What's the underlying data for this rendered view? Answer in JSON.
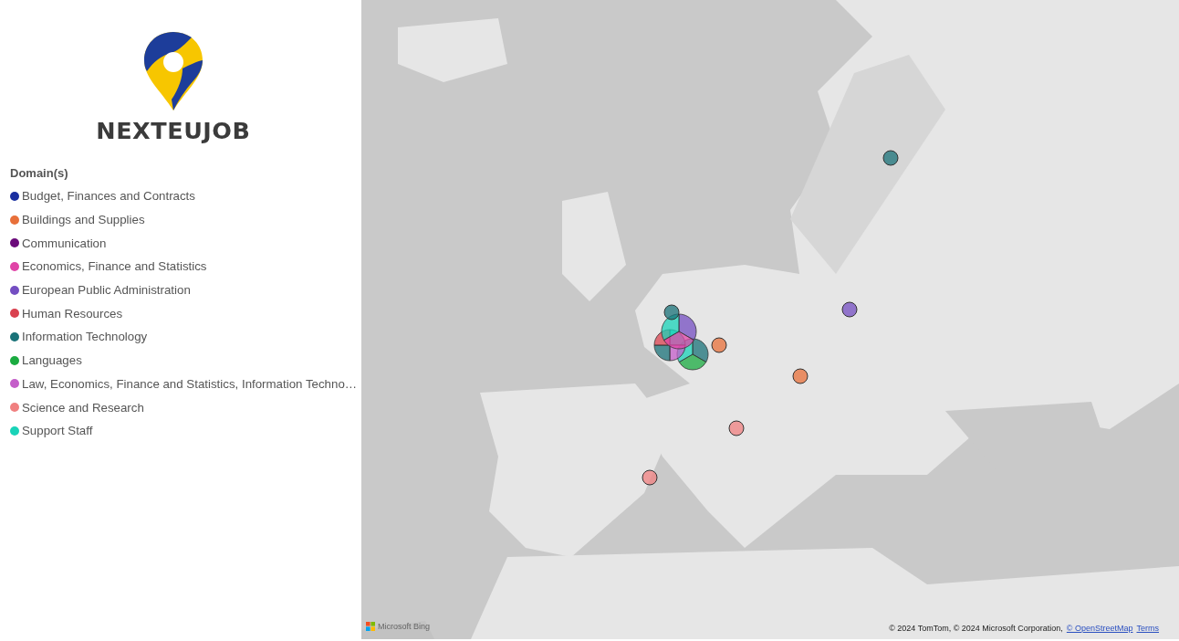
{
  "logo": {
    "name": "NEXTEUJOB"
  },
  "legend": {
    "title": "Domain(s)",
    "items": [
      {
        "label": "Budget, Finances and Contracts",
        "color": "#1a2fa0"
      },
      {
        "label": "Buildings and Supplies",
        "color": "#e8703a"
      },
      {
        "label": "Communication",
        "color": "#6b0a7a"
      },
      {
        "label": "Economics, Finance and Statistics",
        "color": "#e044a7"
      },
      {
        "label": "European Public Administration",
        "color": "#744ec2"
      },
      {
        "label": "Human Resources",
        "color": "#d9414f"
      },
      {
        "label": "Information Technology",
        "color": "#197278"
      },
      {
        "label": "Languages",
        "color": "#1aab40"
      },
      {
        "label": "Law, Economics, Finance and Statistics, Information Techno…",
        "color": "#c45ec9"
      },
      {
        "label": "Science and Research",
        "color": "#f08080"
      },
      {
        "label": "Support Staff",
        "color": "#19d3b8"
      }
    ]
  },
  "map": {
    "kind": "picture",
    "provider": "Microsoft Bing",
    "attribution": "© 2024 TomTom, © 2024 Microsoft Corporation,",
    "links": [
      "© OpenStreetMap",
      "Terms"
    ]
  }
}
